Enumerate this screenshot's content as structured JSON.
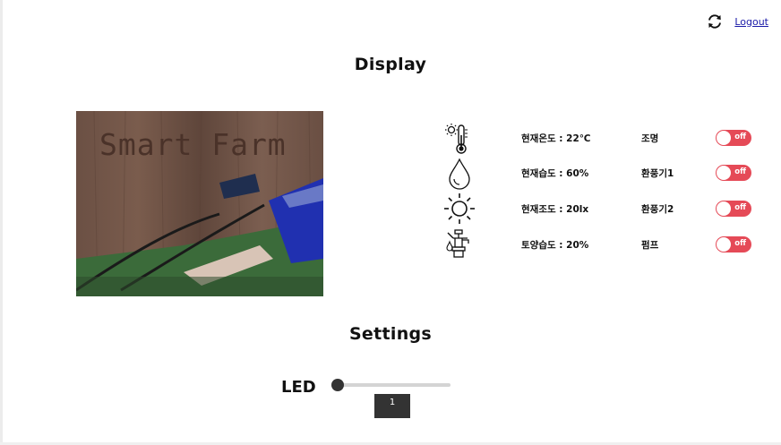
{
  "header": {
    "refresh_icon": "refresh-icon",
    "logout_label": "Logout"
  },
  "display": {
    "title": "Display",
    "camera": {
      "overlay_text": "Smart Farm"
    },
    "sensors": [
      {
        "icon": "thermometer-icon",
        "text": "현재온도 : 22℃"
      },
      {
        "icon": "water-drop-icon",
        "text": "현재습도 : 60%"
      },
      {
        "icon": "sun-icon",
        "text": "현재조도 : 20lx"
      },
      {
        "icon": "water-pump-icon",
        "text": "토양습도 : 20%"
      }
    ],
    "devices": [
      {
        "name": "조명",
        "state": "off"
      },
      {
        "name": "환풍기1",
        "state": "off"
      },
      {
        "name": "환풍기2",
        "state": "off"
      },
      {
        "name": "펌프",
        "state": "off"
      }
    ],
    "switch_color": "#e54a57"
  },
  "settings": {
    "title": "Settings",
    "led": {
      "label": "LED",
      "value": "1",
      "min": 1,
      "max": 100
    }
  }
}
